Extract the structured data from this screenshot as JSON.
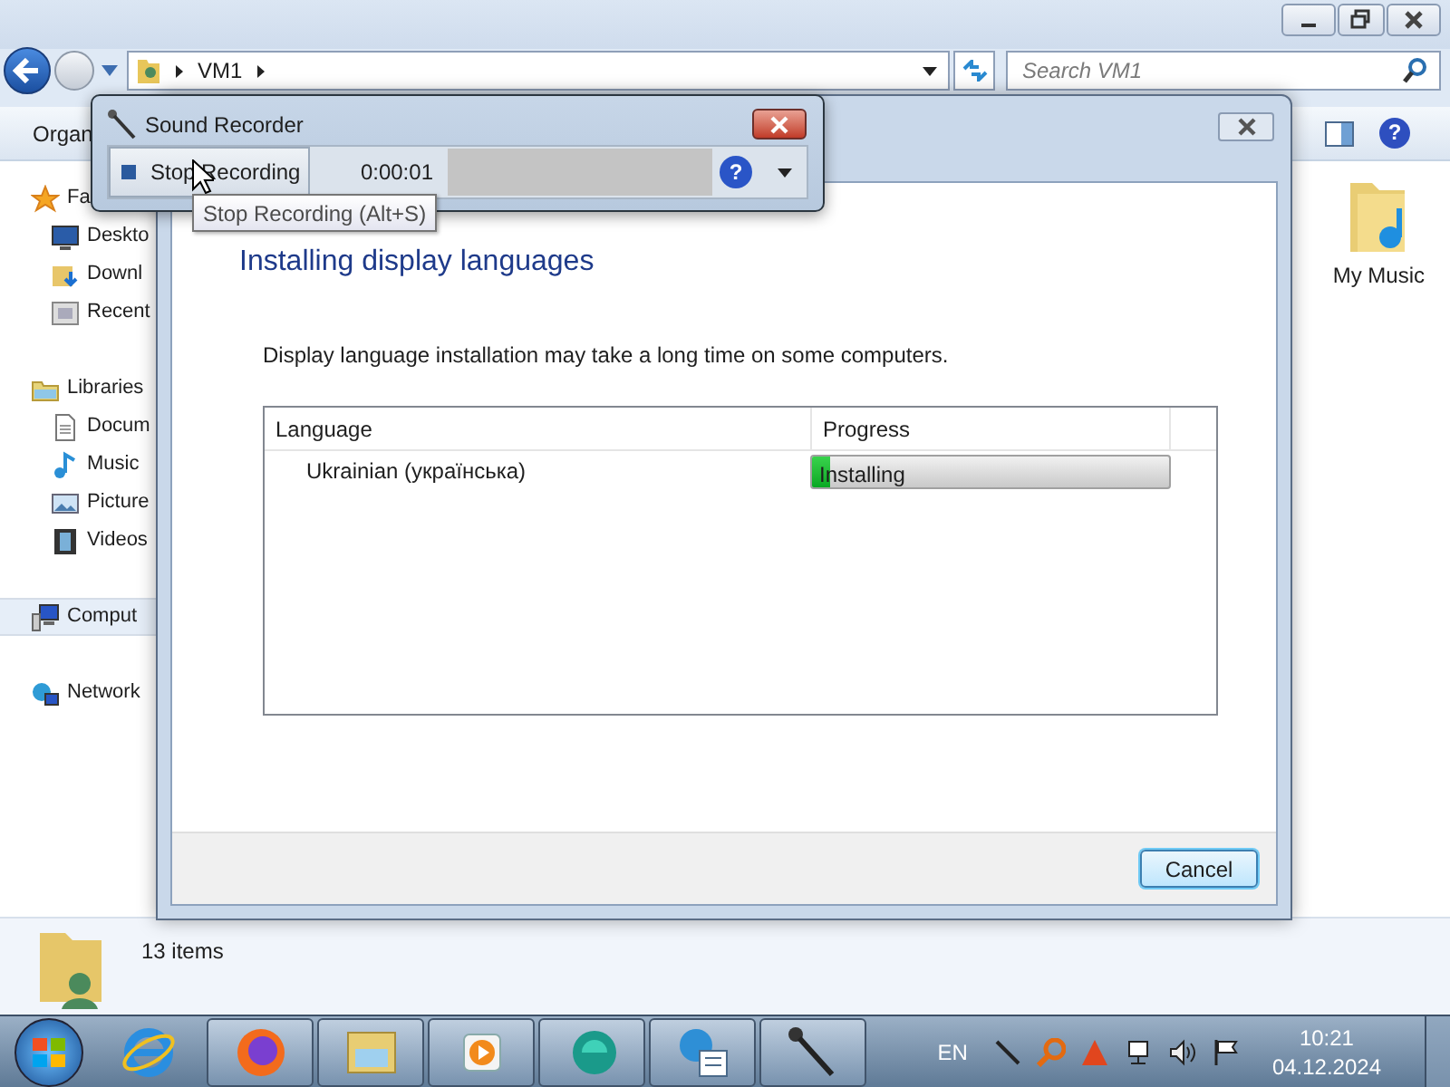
{
  "explorer": {
    "address": {
      "path": [
        "VM1"
      ]
    },
    "search": {
      "placeholder": "Search VM1"
    },
    "toolbar": {
      "organize": "Organ",
      "help": "?"
    },
    "sidebar": {
      "items": [
        {
          "label": "Fa",
          "kind": "star",
          "selected": false,
          "children": [
            {
              "label": "Deskto",
              "kind": "desktop",
              "selected": false
            },
            {
              "label": "Downl",
              "kind": "download",
              "selected": false
            },
            {
              "label": "Recent",
              "kind": "recent",
              "selected": false
            }
          ]
        },
        {
          "label": "Libraries",
          "kind": "library",
          "selected": false,
          "children": [
            {
              "label": "Docum",
              "kind": "document",
              "selected": false
            },
            {
              "label": "Music",
              "kind": "music",
              "selected": false
            },
            {
              "label": "Picture",
              "kind": "picture",
              "selected": false
            },
            {
              "label": "Videos",
              "kind": "video",
              "selected": false
            }
          ]
        },
        {
          "label": "Comput",
          "kind": "computer",
          "selected": true
        },
        {
          "label": "Network",
          "kind": "network",
          "selected": false
        }
      ]
    },
    "files": [
      {
        "label": "My Music"
      }
    ],
    "status": {
      "count": "13 items"
    }
  },
  "language_dialog": {
    "heading": "Installing display languages",
    "message": "Display language installation may take a long time on some computers.",
    "table": {
      "columns": [
        "Language",
        "Progress"
      ],
      "rows": [
        {
          "language": "Ukrainian (українська)",
          "status": "Installing",
          "level": 0.05
        }
      ]
    },
    "cancel": "Cancel"
  },
  "sound_recorder": {
    "title": "Sound Recorder",
    "button": "Stop Recording",
    "time": "0:00:01",
    "help": "?",
    "tooltip": "Stop Recording (Alt+S)"
  },
  "taskbar": {
    "apps": [
      {
        "kind": "browser-e"
      },
      {
        "kind": "browser-fox"
      },
      {
        "kind": "folders"
      },
      {
        "kind": "player"
      },
      {
        "kind": "round-app"
      },
      {
        "kind": "globe-list"
      },
      {
        "kind": "microphone"
      }
    ],
    "language": "EN",
    "time": "10:21",
    "date": "04.12.2024"
  }
}
